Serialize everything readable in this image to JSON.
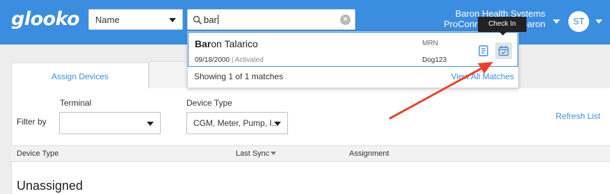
{
  "app": {
    "logo": "glooko"
  },
  "header": {
    "search_type": "Name",
    "search_value": "bar",
    "org_line1": "Baron Health Systems",
    "org_line2": "ProConnect: baron baron",
    "avatar_initials": "ST"
  },
  "search_results": {
    "patient_name_match": "Bar",
    "patient_name_rest": "on Talarico",
    "dob": "09/18/2000",
    "separator": " | ",
    "status": "Activated",
    "mrn_label": "MRN",
    "mrn_value": "Dog123",
    "summary": "Showing 1 of 1 matches",
    "view_all": "View All Matches",
    "check_in_tooltip": "Check In"
  },
  "tabs": [
    {
      "label": "Assign Devices",
      "active": true
    },
    {
      "label": "",
      "active": false
    }
  ],
  "filters": {
    "filter_by_label": "Filter by",
    "terminal_label": "Terminal",
    "terminal_value": "",
    "device_type_label": "Device Type",
    "device_type_value": "CGM, Meter, Pump, I...",
    "refresh_label": "Refresh List"
  },
  "table": {
    "columns": [
      "Device Type",
      "Last Sync",
      "Assignment"
    ],
    "section_title": "Unassigned"
  },
  "icons": {
    "search": "search-icon",
    "clear": "clear-icon",
    "profile": "patient-profile-icon",
    "check_in": "calendar-check-icon"
  },
  "colors": {
    "brand_blue": "#3b8de0",
    "annotation_arrow": "#f0402a",
    "tooltip_bg": "#222222"
  }
}
